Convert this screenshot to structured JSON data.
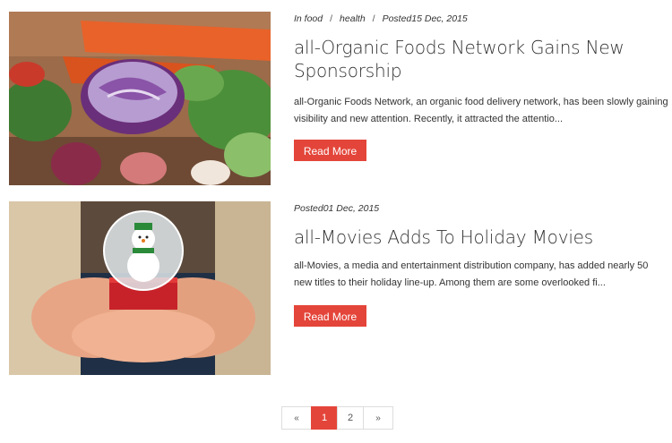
{
  "posts": [
    {
      "meta_in": "In food",
      "meta_tag": "health",
      "meta_posted": "Posted15 Dec, 2015",
      "title": "all-Organic Foods Network Gains New Sponsorship",
      "excerpt": "all-Organic Foods Network, an organic food delivery network, has been slowly gaining visibility and new attention. Recently, it attracted the attentio...",
      "read_more": "Read More",
      "image": "vegetables-photo"
    },
    {
      "meta_posted": "Posted01 Dec, 2015",
      "title": "all-Movies Adds To Holiday Movies",
      "excerpt": "all-Movies, a media and entertainment distribution company, has added nearly 50 new titles to their holiday line-up. Among them are some overlooked fi...",
      "read_more": "Read More",
      "image": "snow-globe-photo"
    }
  ],
  "pagination": {
    "prev": "«",
    "pages": [
      "1",
      "2"
    ],
    "current": "1",
    "next": "»"
  },
  "colors": {
    "accent": "#e4453a",
    "text": "#333333"
  }
}
